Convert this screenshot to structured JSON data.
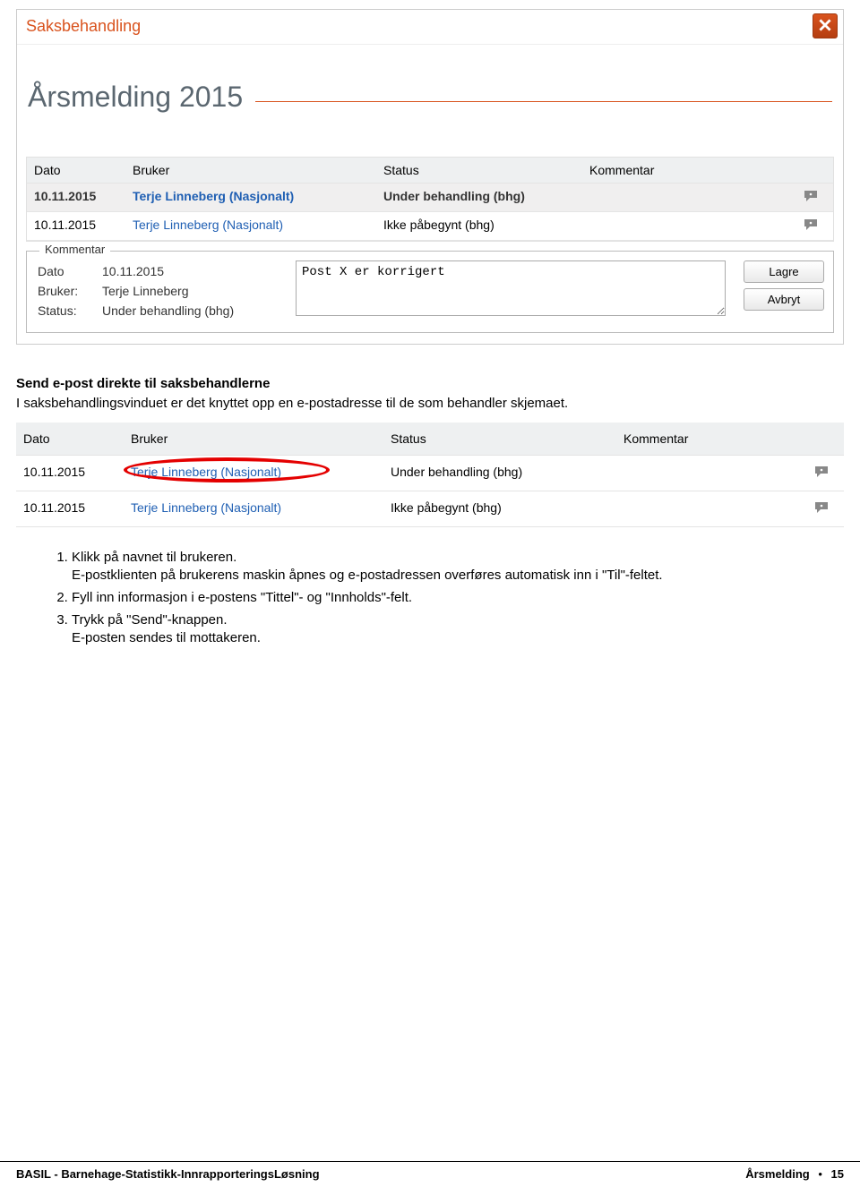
{
  "app": {
    "header_title": "Saksbehandling",
    "page_title": "Årsmelding 2015"
  },
  "grid1": {
    "headers": {
      "date": "Dato",
      "user": "Bruker",
      "status": "Status",
      "comment": "Kommentar"
    },
    "rows": [
      {
        "date": "10.11.2015",
        "user": "Terje Linneberg (Nasjonalt)",
        "status": "Under behandling (bhg)",
        "selected": true
      },
      {
        "date": "10.11.2015",
        "user": "Terje Linneberg (Nasjonalt)",
        "status": "Ikke påbegynt (bhg)",
        "selected": false
      }
    ]
  },
  "kommentar": {
    "legend": "Kommentar",
    "meta": {
      "date_label": "Dato",
      "date_value": "10.11.2015",
      "user_label": "Bruker:",
      "user_value": "Terje Linneberg",
      "status_label": "Status:",
      "status_value": "Under behandling (bhg)"
    },
    "text_value": "Post X er korrigert",
    "buttons": {
      "save": "Lagre",
      "cancel": "Avbryt"
    }
  },
  "section": {
    "heading": "Send e-post direkte til saksbehandlerne",
    "paragraph": "I saksbehandlingsvinduet er det knyttet opp en e-postadresse til de som behandler skjemaet."
  },
  "grid2": {
    "headers": {
      "date": "Dato",
      "user": "Bruker",
      "status": "Status",
      "comment": "Kommentar"
    },
    "rows": [
      {
        "date": "10.11.2015",
        "user": "Terje Linneberg (Nasjonalt)",
        "status": "Under behandling (bhg)",
        "circled": true
      },
      {
        "date": "10.11.2015",
        "user": "Terje Linneberg (Nasjonalt)",
        "status": "Ikke påbegynt (bhg)",
        "circled": false
      }
    ]
  },
  "instructions": {
    "items": [
      {
        "main": "Klikk på navnet til brukeren.",
        "sub": "E-postklienten på brukerens maskin åpnes og e-postadressen overføres automatisk inn i \"Til\"-feltet."
      },
      {
        "main": "Fyll inn informasjon i e-postens \"Tittel\"- og \"Innholds\"-felt."
      },
      {
        "main": "Trykk på \"Send\"-knappen.",
        "sub": "E-posten sendes til mottakeren."
      }
    ]
  },
  "footer": {
    "left": "BASIL - Barnehage-Statistikk-InnrapporteringsLøsning",
    "right_section": "Årsmelding",
    "right_page": "15"
  }
}
